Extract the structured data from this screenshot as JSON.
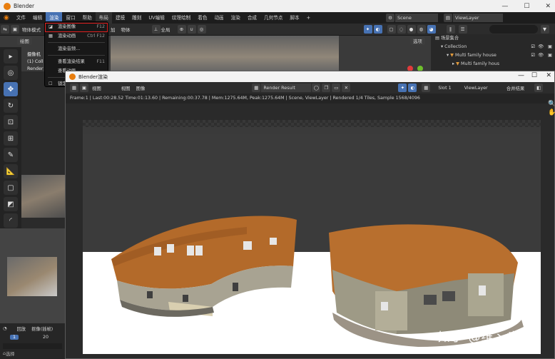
{
  "window": {
    "title": "Blender",
    "min": "—",
    "max": "☐",
    "close": "✕"
  },
  "menubar": {
    "items": [
      "文件",
      "编辑",
      "渲染",
      "窗口",
      "帮助"
    ],
    "workspaces": [
      "布局",
      "建模",
      "雕刻",
      "UV编辑",
      "纹理绘制",
      "着色",
      "动画",
      "渲染",
      "合成",
      "几何节点",
      "脚本"
    ],
    "add_tab": "+",
    "scene": "Scene",
    "view_layer": "ViewLayer"
  },
  "toolbar": {
    "mode": "物体模式",
    "menu_add": "加",
    "menu_object": "物体",
    "transform_global": "全局",
    "options": "选项"
  },
  "render_menu": {
    "items": [
      {
        "label": "渲染图像",
        "key": "F12"
      },
      {
        "label": "渲染动画",
        "key": "Ctrl F12"
      },
      {
        "label": "渲染音频...",
        "key": ""
      },
      {
        "label": "查看渲染结果",
        "key": "F11"
      },
      {
        "label": "查看动画",
        "key": ""
      },
      {
        "label": "锁定界面",
        "key": ""
      }
    ]
  },
  "viewport_overlay": {
    "tab": "绘图",
    "line1": "摄像机",
    "line2": "(1) Coll",
    "line3": "Render"
  },
  "outliner": {
    "title": "场景集合",
    "rows": [
      "Collection",
      "Multi family house",
      "Multi family hous"
    ]
  },
  "render_window": {
    "title": "Blender渲染",
    "menu": [
      "视图",
      "图像"
    ],
    "image_name": "Render Result",
    "slot": "Slot 1",
    "view_layer": "ViewLayer",
    "pass": "合并结果",
    "status": "Frame:1 | Last:00:28.52 Time:01:13.60 | Remaining:00:37.78 | Mem:1275.64M, Peak:1275.64M | Scene, ViewLayer | Rendered 1/4 Tiles, Sample 1568/4096"
  },
  "timeline": {
    "menu1": "回放",
    "menu2": "抠像(插帧)",
    "frame_current": "1",
    "frame_mark": "20",
    "select_label": "选择"
  },
  "watermark": "知乎 @维丶痂"
}
